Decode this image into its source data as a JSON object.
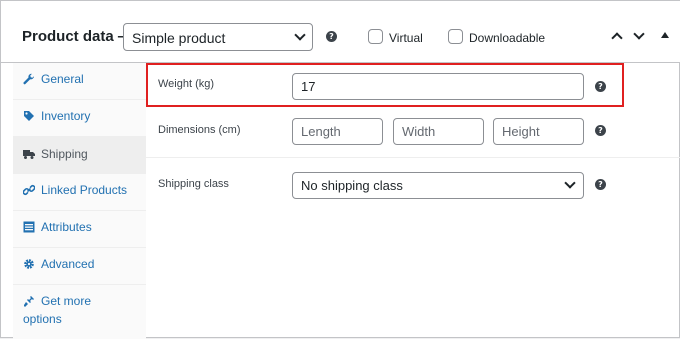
{
  "header": {
    "title": "Product data —",
    "product_type": "Simple product",
    "virtual_label": "Virtual",
    "downloadable_label": "Downloadable",
    "help_glyph": "?"
  },
  "sidebar": {
    "items": [
      {
        "label": "General",
        "icon": "wrench-icon"
      },
      {
        "label": "Inventory",
        "icon": "tag-icon"
      },
      {
        "label": "Shipping",
        "icon": "truck-icon"
      },
      {
        "label": "Linked Products",
        "icon": "link-icon"
      },
      {
        "label": "Attributes",
        "icon": "list-icon"
      },
      {
        "label": "Advanced",
        "icon": "gear-icon"
      },
      {
        "label_line1": "Get more",
        "label_line2": "options",
        "icon": "plugin-icon"
      }
    ]
  },
  "shipping": {
    "weight_label": "Weight (kg)",
    "weight_value": "17",
    "dimensions_label": "Dimensions (cm)",
    "length_placeholder": "Length",
    "width_placeholder": "Width",
    "height_placeholder": "Height",
    "shipping_class_label": "Shipping class",
    "shipping_class_value": "No shipping class"
  },
  "colors": {
    "highlight": "#e02020",
    "link": "#2271b1",
    "active_tab_bg": "#eeeeee"
  }
}
